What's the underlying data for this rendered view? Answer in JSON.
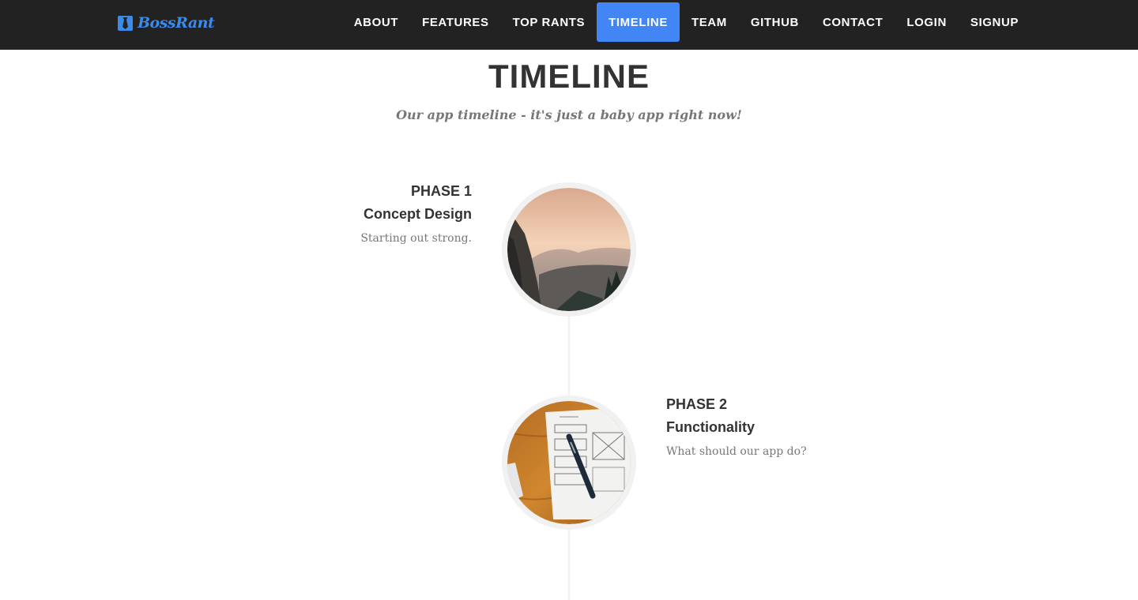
{
  "navbar": {
    "brand": {
      "text": "BossRant",
      "icon": "tie-icon"
    },
    "items": [
      {
        "label": "ABOUT"
      },
      {
        "label": "FEATURES"
      },
      {
        "label": "TOP RANTS"
      },
      {
        "label": "TIMELINE",
        "active": true
      },
      {
        "label": "TEAM"
      },
      {
        "label": "GITHUB"
      },
      {
        "label": "CONTACT"
      },
      {
        "label": "LOGIN"
      },
      {
        "label": "SIGNUP"
      }
    ]
  },
  "section": {
    "heading": "TIMELINE",
    "subheading": "Our app timeline - it's just a baby app right now!"
  },
  "timeline": [
    {
      "phase": "PHASE 1",
      "title": "Concept Design",
      "description": "Starting out strong.",
      "image": "mountain-valley-photo"
    },
    {
      "phase": "PHASE 2",
      "title": "Functionality",
      "description": "What should our app do?",
      "image": "wireframe-sketch-photo"
    }
  ],
  "colors": {
    "navbar_bg": "#222222",
    "accent": "#4285f4",
    "brand": "#3b8beb",
    "heading": "#333333",
    "muted_text": "#777777"
  }
}
